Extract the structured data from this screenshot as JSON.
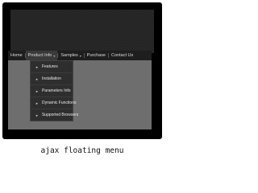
{
  "menubar": {
    "items": [
      {
        "label": "Home"
      },
      {
        "label": "Product Info"
      },
      {
        "label": "Samples"
      },
      {
        "label": "Purchase"
      },
      {
        "label": "Contact Us"
      }
    ]
  },
  "dropdown": {
    "items": [
      {
        "label": "Features"
      },
      {
        "label": "Installation"
      },
      {
        "label": "Parameters Info"
      },
      {
        "label": "Dynamic Functions"
      },
      {
        "label": "Supported Browsers"
      }
    ]
  },
  "caption": "ajax floating menu",
  "colors": {
    "frame": "#000000",
    "menubar": "#1e1e1e",
    "dropdown": "#2e2e2e",
    "content": "#6e6e6e"
  }
}
